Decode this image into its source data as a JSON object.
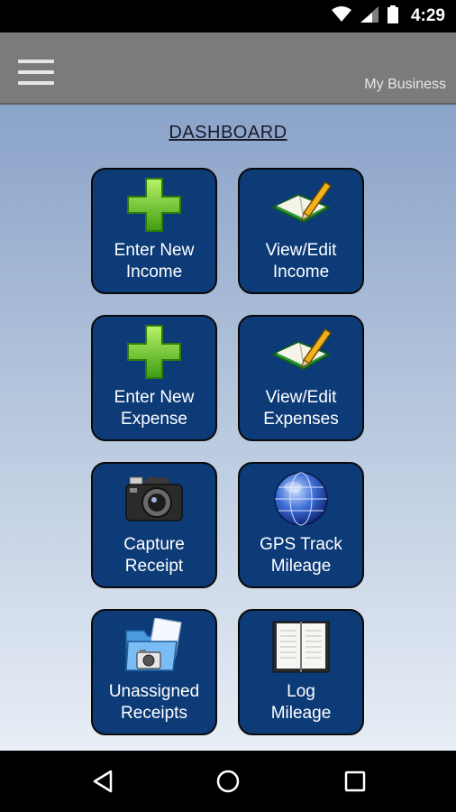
{
  "status_bar": {
    "time": "4:29"
  },
  "app_bar": {
    "business_name": "My Business"
  },
  "dashboard": {
    "title": "DASHBOARD",
    "tiles": [
      {
        "line1": "Enter New",
        "line2": "Income",
        "icon": "green-plus-icon"
      },
      {
        "line1": "View/Edit",
        "line2": "Income",
        "icon": "book-pencil-icon"
      },
      {
        "line1": "Enter New",
        "line2": "Expense",
        "icon": "green-plus-icon"
      },
      {
        "line1": "View/Edit",
        "line2": "Expenses",
        "icon": "book-pencil-icon"
      },
      {
        "line1": "Capture",
        "line2": "Receipt",
        "icon": "camera-icon"
      },
      {
        "line1": "GPS Track",
        "line2": "Mileage",
        "icon": "globe-icon"
      },
      {
        "line1": "Unassigned",
        "line2": "Receipts",
        "icon": "folder-camera-icon"
      },
      {
        "line1": "Log",
        "line2": "Mileage",
        "icon": "open-book-icon"
      }
    ]
  }
}
